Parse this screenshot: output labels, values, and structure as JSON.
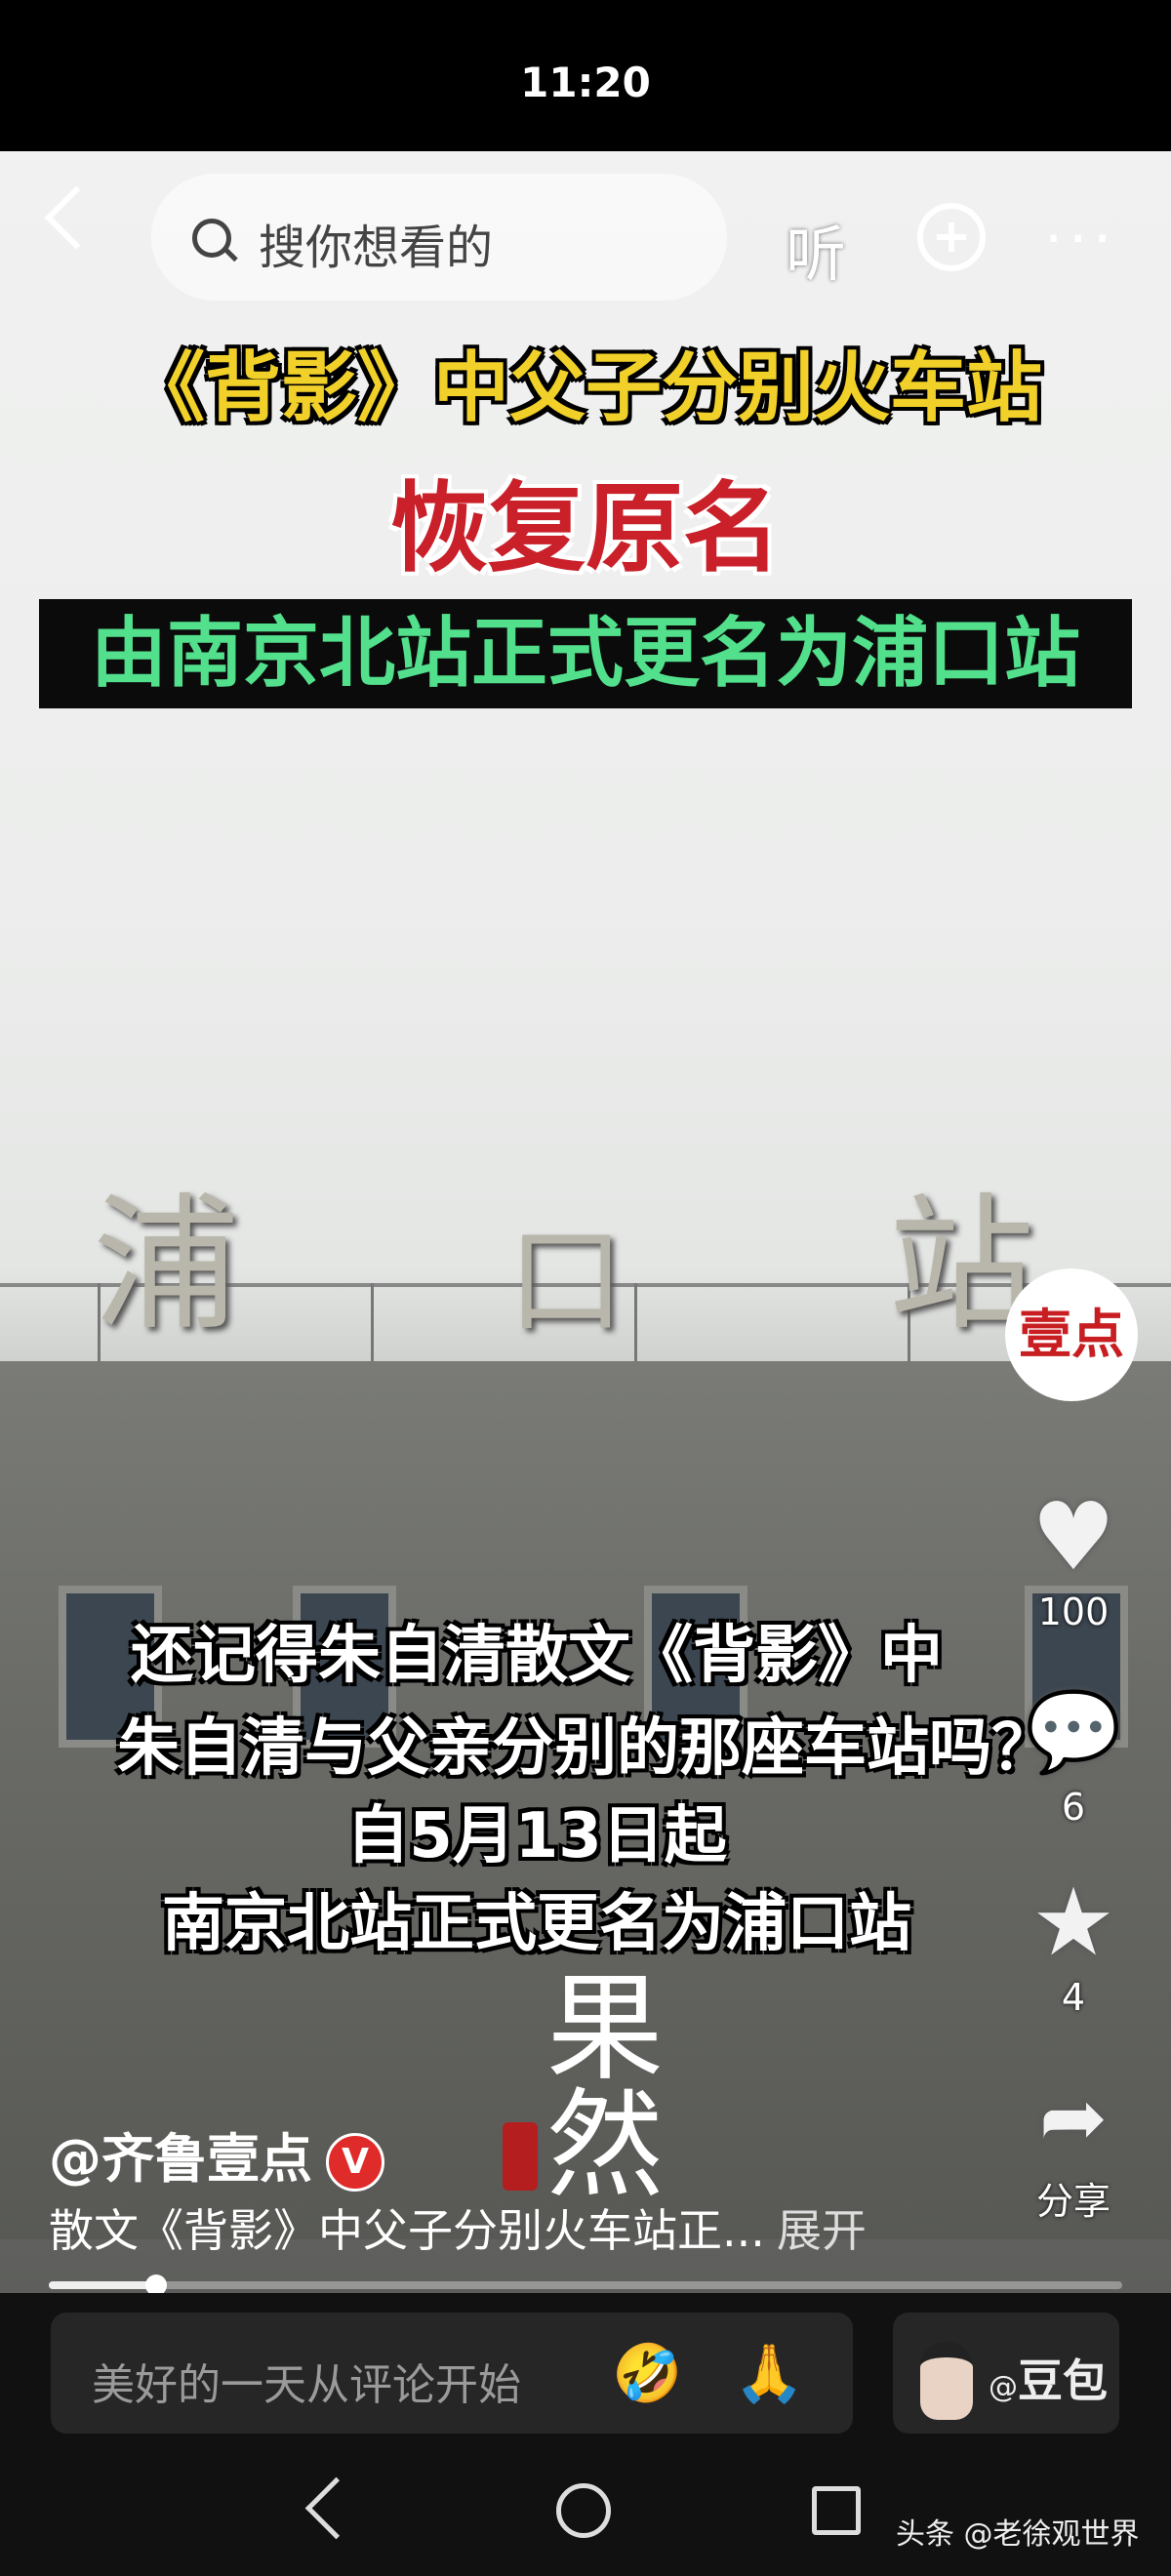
{
  "status_bar": {
    "time": "11:20"
  },
  "top_nav": {
    "search_placeholder": "搜你想看的",
    "listen_label": "听"
  },
  "video": {
    "headline_line1": "《背影》中父子分别火车站",
    "headline_line2": "恢复原名",
    "headline_line3": "由南京北站正式更名为浦口站",
    "sign_chars": [
      "浦",
      "口",
      "站"
    ],
    "captions": [
      "还记得朱自清散文《背影》中",
      "朱自清与父亲分别的那座车站吗？",
      "自5月13日起",
      "南京北站正式更名为浦口站"
    ],
    "channel_logo": "壹点",
    "watermark_text": "果然",
    "progress_fraction": 0.1
  },
  "actions": {
    "likes": "100",
    "comments": "6",
    "favorites": "4",
    "share_label": "分享"
  },
  "post": {
    "author": "@齐鲁壹点",
    "verified_badge": "V",
    "description": "散文《背影》中父子分别火车站正...",
    "expand_label": "展开"
  },
  "bottom_bar": {
    "comment_placeholder": "美好的一天从评论开始",
    "emoji1": "🤣",
    "emoji2": "🙏",
    "doubao_label": "豆包",
    "doubao_at": "@"
  },
  "source_watermark": "头条 @老徐观世界"
}
